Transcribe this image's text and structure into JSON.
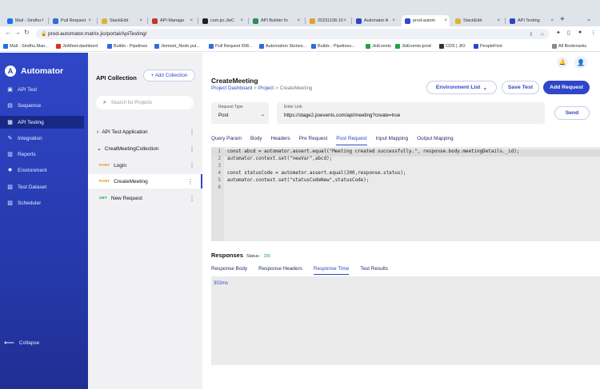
{
  "browser": {
    "tabs": [
      {
        "label": "Mail - Sindhu",
        "color": "#1a73e8"
      },
      {
        "label": "Pull Request",
        "color": "#2f6fd6"
      },
      {
        "label": "StackEdit",
        "color": "#e2b13c"
      },
      {
        "label": "API Manage",
        "color": "#c0392b"
      },
      {
        "label": "com.jio.JioC",
        "color": "#222222"
      },
      {
        "label": "API Builder fo",
        "color": "#2e8b57"
      },
      {
        "label": "20231108.10",
        "color": "#e0a030"
      },
      {
        "label": "Automator A",
        "color": "#2f46c8"
      },
      {
        "label": "prod-autom",
        "color": "#2f46c8"
      },
      {
        "label": "StackEdit",
        "color": "#e2b13c"
      },
      {
        "label": "API Testing",
        "color": "#2f46c8"
      }
    ],
    "url": "prod-automator.matrix.jio/portal/ApiTesting/",
    "bookmarks": [
      {
        "label": "Mail - Sindhu.Man...",
        "color": "#1a73e8"
      },
      {
        "label": "JioMeet-dashbord",
        "color": "#d93025"
      },
      {
        "label": "Builds - Pipelines",
        "color": "#2f6fd6"
      },
      {
        "label": "Jiomeet_Node pul...",
        "color": "#2f6fd6"
      },
      {
        "label": "Pull Request 698...",
        "color": "#2f6fd6"
      },
      {
        "label": "Automation Stories...",
        "color": "#2f6fd6"
      },
      {
        "label": "Builds - Pipelines...",
        "color": "#2f6fd6"
      },
      {
        "label": "JioEvents",
        "color": "#1fa34a"
      },
      {
        "label": "JioEvents-prod",
        "color": "#1fa34a"
      },
      {
        "label": "CDS | JIO",
        "color": "#333333"
      },
      {
        "label": "PeopleFirst",
        "color": "#2f46c8"
      }
    ],
    "all_bookmarks": "All Bookmarks"
  },
  "sidebar": {
    "brand": "Automator",
    "items": [
      {
        "label": "API Test",
        "icon": "▣"
      },
      {
        "label": "Sequence",
        "icon": "▤"
      },
      {
        "label": "API Testing",
        "icon": "▦"
      },
      {
        "label": "Integration",
        "icon": "✎"
      },
      {
        "label": "Reports",
        "icon": "▥"
      },
      {
        "label": "Environment",
        "icon": "✹"
      },
      {
        "label": "Test Dataset",
        "icon": "▧"
      },
      {
        "label": "Scheduler",
        "icon": "▨"
      }
    ],
    "collapse": "Collapse"
  },
  "collections": {
    "title": "API Collection",
    "add_label": "+ Add Collection",
    "search_placeholder": "Search for Projects",
    "tree": [
      {
        "label": "API Test Application",
        "prefix": "›"
      },
      {
        "label": "CreatMeetingCollection",
        "prefix": "⌄"
      },
      {
        "label": "Login",
        "method": "POST"
      },
      {
        "label": "CreateMeeting",
        "method": "POST"
      },
      {
        "label": "New Request",
        "method": "GET"
      }
    ]
  },
  "request": {
    "title": "CreateMeeting",
    "breadcrumb": [
      "Project Dashboard",
      "Project",
      "CreateMeeting"
    ],
    "env_label": "Environment List",
    "save_label": "Save Test",
    "add_label": "Add Request",
    "type_label": "Request Type",
    "type_value": "Post",
    "link_label": "Enter Link",
    "link_value": "https://stage2.jioevents.com/api/meeting?create=true",
    "send_label": "Send",
    "tabs": [
      "Query Param",
      "Body",
      "Headers",
      "Pre Request",
      "Post Request",
      "Input Mapping",
      "Output Mapping"
    ],
    "active_tab": "Post Request",
    "code": [
      "const abcd = automator.assert.equal(\"Meeting created successfully.\", response.body.meetingDetails._id);",
      "automator.context.set(\"newVar\",abcd);",
      "",
      "const statusCode = automator.assert.equal(200,response.status);",
      "automator.context.set(\"statusCodeNew\",statusCode);",
      ""
    ]
  },
  "responses": {
    "title": "Responses",
    "status_label": "Status :",
    "status_code": "200",
    "tabs": [
      "Response Body",
      "Response Headers",
      "Response Time",
      "Test Results"
    ],
    "active_tab": "Response Time",
    "value": "302ms"
  },
  "colors": {
    "accent": "#2f46c8",
    "post": "#e08a1c",
    "get": "#1fa34a"
  }
}
